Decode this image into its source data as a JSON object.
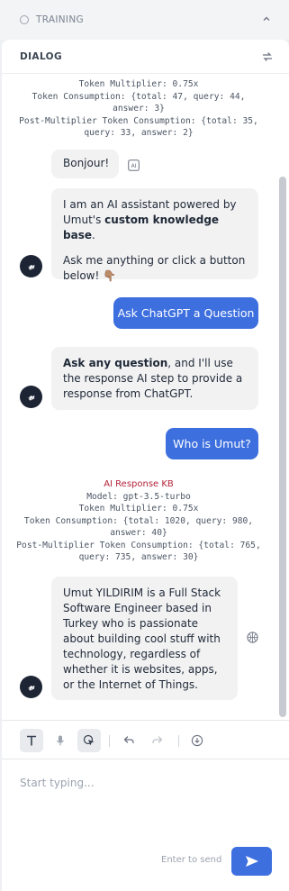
{
  "training": {
    "label": "TRAINING"
  },
  "dialog": {
    "title": "DIALOG"
  },
  "meta_top": {
    "line1": "Token Multiplier: 0.75x",
    "line2": "Token Consumption: {total: 47, query: 44,",
    "line3": "answer: 3}",
    "line4": "Post-Multiplier Token Consumption: {total: 35,",
    "line5": "query: 33, answer: 2}"
  },
  "messages": {
    "bonjour": "Bonjour!",
    "intro_a": "I am an AI assistant powered by Umut's ",
    "intro_b": "custom knowledge base",
    "intro_c": ".",
    "intro_2": "Ask me anything or click a button below! 👇🏽",
    "ask_chatgpt": "Ask ChatGPT a Question",
    "ask_any_b": "Ask any question",
    "ask_any_rest": ", and I'll use the response AI step to provide a response from ChatGPT.",
    "who": "Who is Umut?",
    "answer": "Umut YILDIRIM is a Full Stack Software Engineer based in Turkey who is passionate about building cool stuff with technology, regardless of whether it is websites, apps, or the Internet of Things."
  },
  "meta_kb": {
    "title": "AI Response KB",
    "model": "Model: gpt-3.5-turbo",
    "multiplier": "Token Multiplier: 0.75x",
    "consumption1": "Token Consumption: {total: 1020, query: 980,",
    "consumption2": "answer: 40}",
    "post1": "Post-Multiplier Token Consumption: {total: 765,",
    "post2": "query: 735, answer: 30}"
  },
  "avatar_letter": "𝓋",
  "composer": {
    "placeholder": "Start typing...",
    "enter_hint": "Enter to send"
  },
  "colors": {
    "accent": "#3d6fdf",
    "ai_title": "#b4233a",
    "avatar_bg": "#1d2434"
  }
}
